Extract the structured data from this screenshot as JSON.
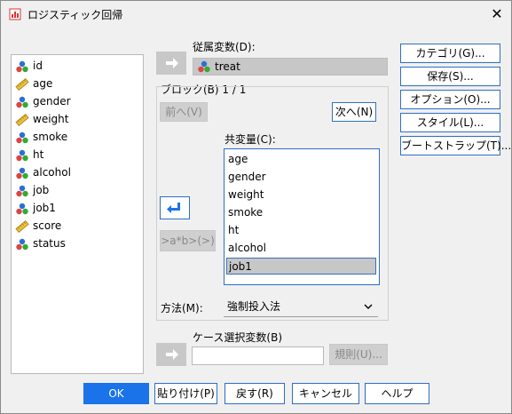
{
  "window": {
    "title": "ロジスティック回帰",
    "close": "✕"
  },
  "variables": [
    {
      "name": "id",
      "icon": "nominal-icon"
    },
    {
      "name": "age",
      "icon": "scale-icon"
    },
    {
      "name": "gender",
      "icon": "nominal-icon"
    },
    {
      "name": "weight",
      "icon": "scale-icon"
    },
    {
      "name": "smoke",
      "icon": "nominal-icon"
    },
    {
      "name": "ht",
      "icon": "nominal-icon"
    },
    {
      "name": "alcohol",
      "icon": "nominal-icon"
    },
    {
      "name": "job",
      "icon": "nominal-icon"
    },
    {
      "name": "job1",
      "icon": "nominal-icon"
    },
    {
      "name": "score",
      "icon": "scale-icon"
    },
    {
      "name": "status",
      "icon": "nominal-icon"
    }
  ],
  "dependent": {
    "label": "従属変数(D):",
    "value": "treat"
  },
  "block": {
    "label": "ブロック(B) 1 / 1",
    "prev": "前へ(V)",
    "next": "次へ(N)",
    "interaction": ">a*b>(>)"
  },
  "covariates": {
    "label": "共変量(C):",
    "items": [
      "age",
      "gender",
      "weight",
      "smoke",
      "ht",
      "alcohol",
      "job1"
    ],
    "selected_index": 6
  },
  "method": {
    "label": "方法(M):",
    "value": "強制投入法"
  },
  "selection": {
    "label": "ケース選択変数(B)",
    "value": "",
    "rule": "規則(U)..."
  },
  "side_buttons": [
    "カテゴリ(G)...",
    "保存(S)...",
    "オプション(O)...",
    "スタイル(L)...",
    "ブートストラップ(T)..."
  ],
  "footer": {
    "ok": "OK",
    "paste": "貼り付け(P)",
    "reset": "戻す(R)",
    "cancel": "キャンセル",
    "help": "ヘルプ"
  },
  "colors": {
    "accent": "#1a73e8",
    "border_blue": "#2f6fbf"
  }
}
